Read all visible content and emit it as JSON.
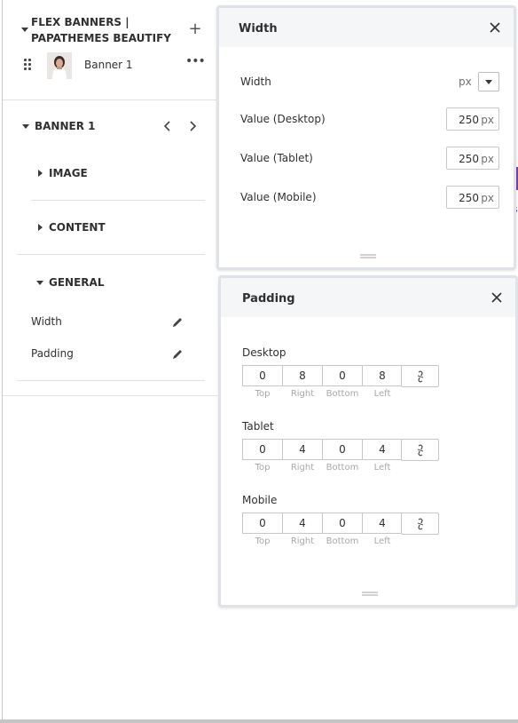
{
  "sidebar": {
    "flex_title": "FLEX BANNERS | PAPATHEMES BEAUTIFY",
    "banner_item": "Banner 1",
    "section_title": "BANNER 1",
    "groups": {
      "image": "IMAGE",
      "content": "CONTENT",
      "general": "GENERAL"
    },
    "settings": {
      "width": "Width",
      "padding": "Padding"
    }
  },
  "width_panel": {
    "title": "Width",
    "width_label": "Width",
    "unit": "px",
    "rows": [
      {
        "label": "Value (Desktop)",
        "value": "250",
        "unit": "px"
      },
      {
        "label": "Value (Tablet)",
        "value": "250",
        "unit": "px"
      },
      {
        "label": "Value (Mobile)",
        "value": "250",
        "unit": "px"
      }
    ]
  },
  "padding_panel": {
    "title": "Padding",
    "captions": {
      "top": "Top",
      "right": "Right",
      "bottom": "Bottom",
      "left": "Left"
    },
    "devices": [
      {
        "label": "Desktop",
        "top": "0",
        "right": "8",
        "bottom": "0",
        "left": "8"
      },
      {
        "label": "Tablet",
        "top": "0",
        "right": "4",
        "bottom": "0",
        "left": "4"
      },
      {
        "label": "Mobile",
        "top": "0",
        "right": "4",
        "bottom": "0",
        "left": "4"
      }
    ]
  },
  "background": {
    "peek_text": "s"
  },
  "colors": {
    "accent_purple": "#7b3fb0",
    "panel_header_bg": "#f5f6f8"
  }
}
